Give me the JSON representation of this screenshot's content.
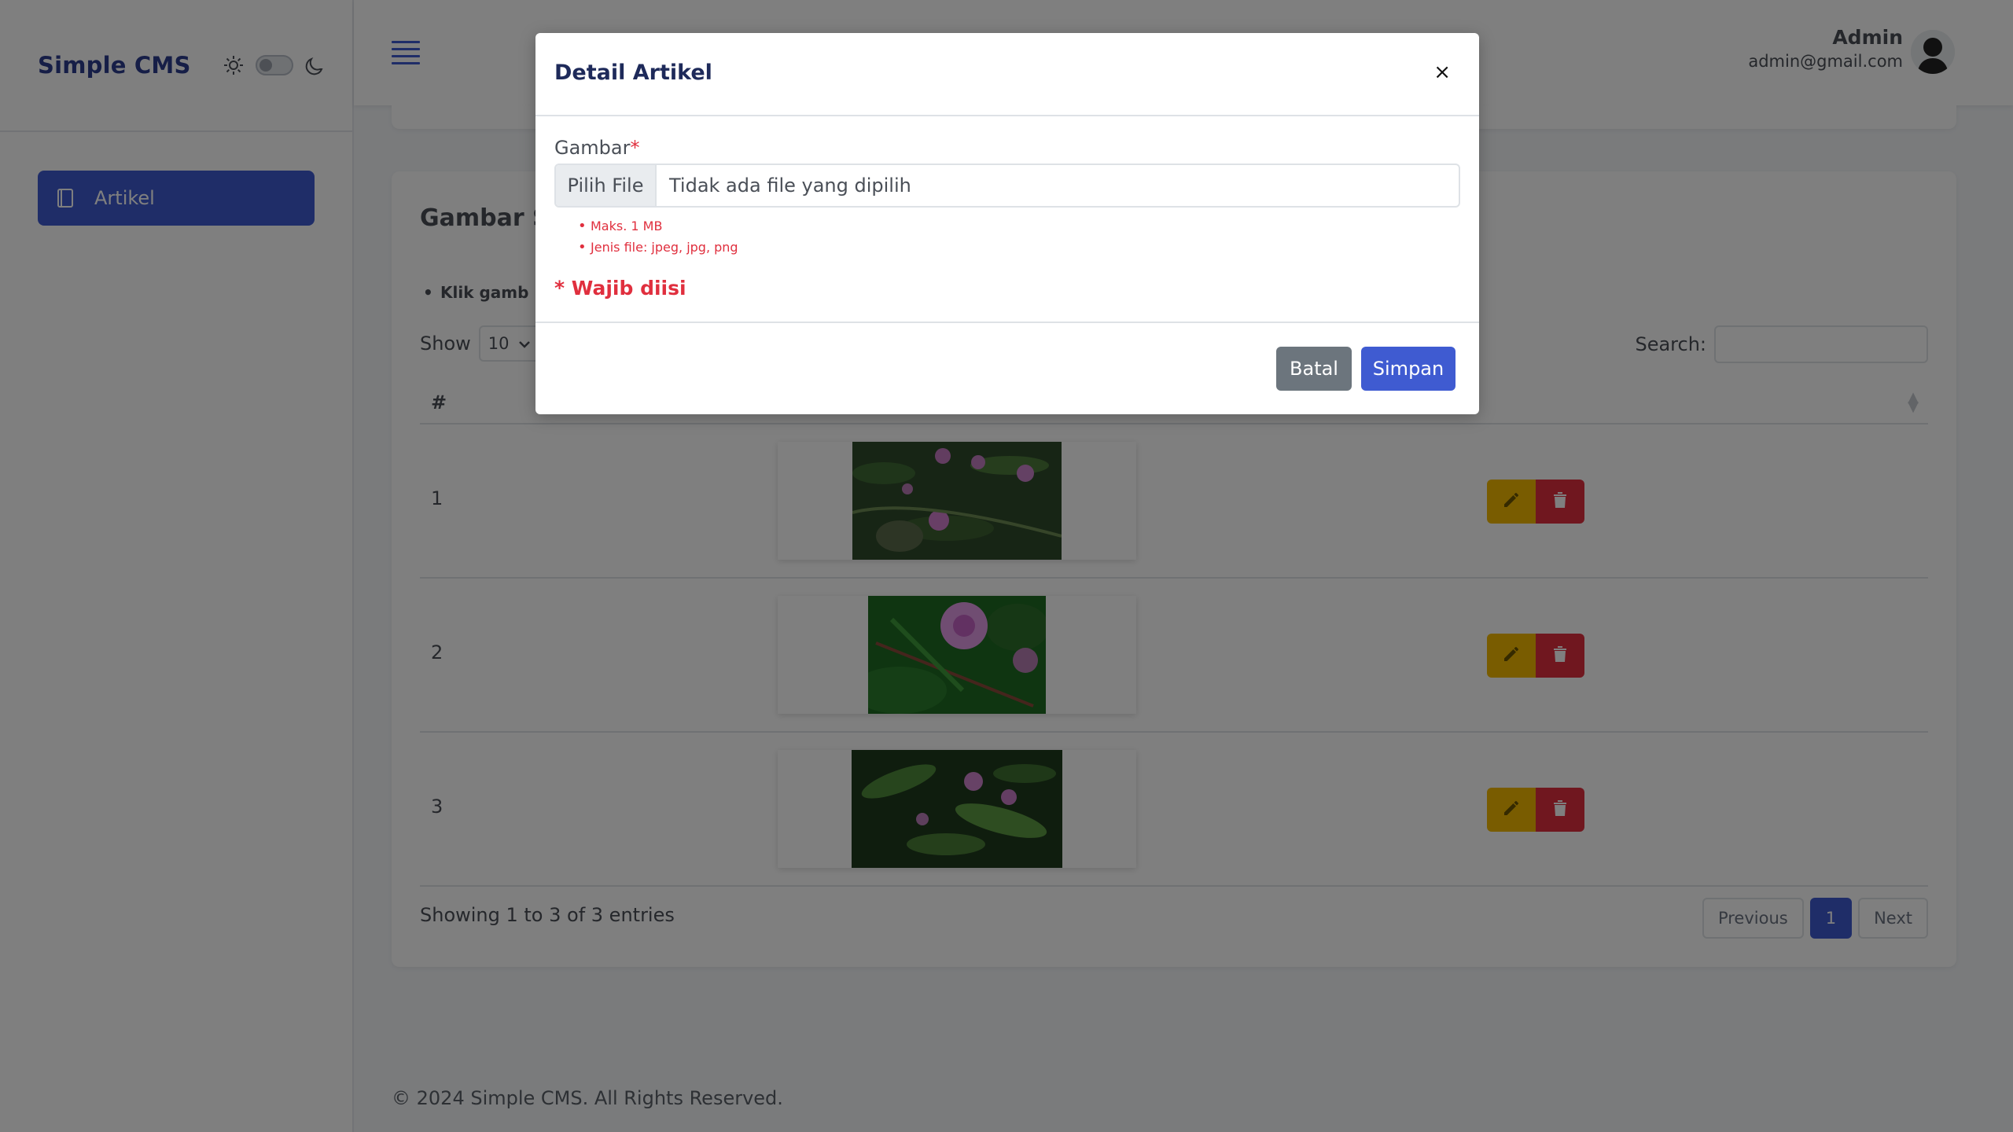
{
  "sidebar": {
    "brand": "Simple CMS",
    "theme_icons": [
      "sun-icon",
      "moon-icon"
    ],
    "items": [
      {
        "label": "Artikel",
        "icon": "article-icon",
        "active": true
      }
    ]
  },
  "topbar": {
    "menu_icon": "hamburger-icon",
    "user_name": "Admin",
    "user_email": "admin@gmail.com"
  },
  "card": {
    "title": "Gambar Sl",
    "hint": "Klik gamb",
    "show_label": "Show",
    "page_length": "10",
    "search_label": "Search:",
    "search_value": "",
    "columns": [
      "#"
    ],
    "rows": [
      {
        "num": "1",
        "image": "mimosa-flowers-1"
      },
      {
        "num": "2",
        "image": "mimosa-flower-2"
      },
      {
        "num": "3",
        "image": "mimosa-leaves-3"
      }
    ],
    "info": "Showing 1 to 3 of 3 entries",
    "pagination": {
      "previous": "Previous",
      "current": "1",
      "next": "Next"
    }
  },
  "footer": "© 2024 Simple CMS. All Rights Reserved.",
  "modal": {
    "title": "Detail Artikel",
    "close": "×",
    "field_label": "Gambar",
    "required_mark": "*",
    "file_button": "Pilih File",
    "file_text": "Tidak ada file yang dipilih",
    "rules": [
      "Maks. 1 MB",
      "Jenis file: jpeg, jpg, png"
    ],
    "required_note": "* Wajib diisi",
    "cancel": "Batal",
    "save": "Simpan"
  },
  "colors": {
    "primary": "#3f5bd1",
    "danger": "#e02f3e",
    "warning": "#f3b800",
    "secondary": "#6c757d"
  }
}
